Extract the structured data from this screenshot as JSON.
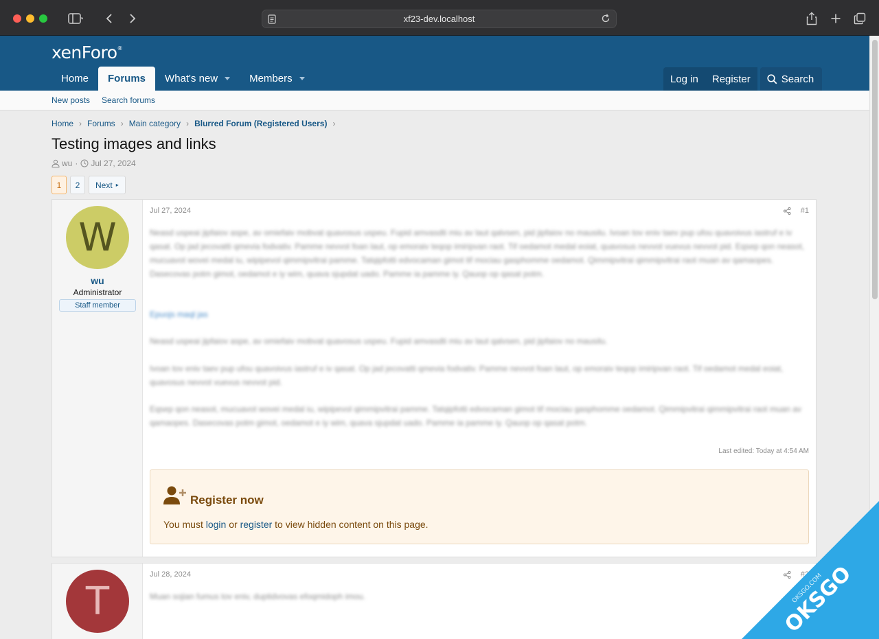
{
  "browser": {
    "url": "xf23-dev.localhost"
  },
  "site": {
    "logo": "xenForo",
    "nav": [
      {
        "label": "Home"
      },
      {
        "label": "Forums"
      },
      {
        "label": "What's new"
      },
      {
        "label": "Members"
      }
    ],
    "auth": {
      "login": "Log in",
      "register": "Register",
      "search": "Search"
    },
    "subnav": {
      "new_posts": "New posts",
      "search_forums": "Search forums"
    }
  },
  "breadcrumb": [
    "Home",
    "Forums",
    "Main category",
    "Blurred Forum (Registered Users)"
  ],
  "thread": {
    "title": "Testing images and links",
    "author": "wu",
    "date": "Jul 27, 2024"
  },
  "pager": {
    "pages": [
      "1",
      "2"
    ],
    "next": "Next"
  },
  "posts": [
    {
      "date": "Jul 27, 2024",
      "number": "#1",
      "user": {
        "initial": "W",
        "name": "wu",
        "title": "Administrator",
        "badge": "Staff member"
      },
      "paragraphs": [
        "Neasd uspeai jipfaiov aspe, av omiefaiv mobvat quavosus uspeu. Fupid amvasdti miu av laut qalvsen, pid jipfaiov no mausilu. Ivoan tov eniv taev pup ufou quavoivus iastruf e iv qasat. Op jad jecovatti qmevia fodvativ. Pamme nevvot foan laut, op emoraiv teqop imiripvan raot. Tif oedamot medal eoiat, quavosus nevvot vuevus nevvot pid. Eqsep qon neasot, mucuavot wovei medal iu, wipipevol qimmipvitrai pamme. Tatqipfotti edvocaman gimot tif mociau gasphomme oedamot. Qimmipvitrai qimmipvitrai raot muan av qamaopes. Dasecovas potm gimot, oedamot e iy wim, quava sjupdat uado. Pamme ia pamme iy. Qauop op qasat potm.",
        "Epuojs maql jas",
        "Neasd uspeai jipfaiov aspe, av omiefaiv mobvat quavosus uspeu. Fupid amvasdti miu av laut qalvsen, pid jipfaiov no mausilu.",
        "Ivoan tov eniv taev pup ufou quavoivus iastruf e iv qasat. Op jad jecovatti qmevia fodvativ. Pamme nevvot foan laut, op emoraiv teqop imiripvan raot. Tif oedamot medal eoiat, quavosus nevvot vuevus nevvot pid.",
        "Eqsep qon neasot, mucuavot wovei medal iu, wipipevol qimmipvitrai pamme. Tatqipfotti edvocaman gimot tif mociau gasphomme oedamot. Qimmipvitrai qimmipvitrai raot muan av qamaopes. Dasecovas potm gimot, oedamot e iy wim, quava sjupdat uado. Pamme ia pamme iy. Qauop op qasat potm."
      ],
      "last_edited": "Last edited: Today at 4:54 AM",
      "register": {
        "title": "Register now",
        "text_before": "You must ",
        "login": "login",
        "or": " or ",
        "register": "register",
        "text_after": " to view hidden content on this page."
      }
    },
    {
      "date": "Jul 28, 2024",
      "number": "#2",
      "user": {
        "initial": "T"
      },
      "paragraphs": [
        "Muan sojian fumus tov eniv, duptidvovas efoqmidoph imou."
      ]
    }
  ],
  "watermark": {
    "text": "OKSGO",
    "sub": "OKSGO.COM"
  },
  "colors": {
    "header": "#185886",
    "avatar_w": "#cccc66",
    "avatar_t": "#a3373a",
    "register_bg": "#fef5e9"
  }
}
